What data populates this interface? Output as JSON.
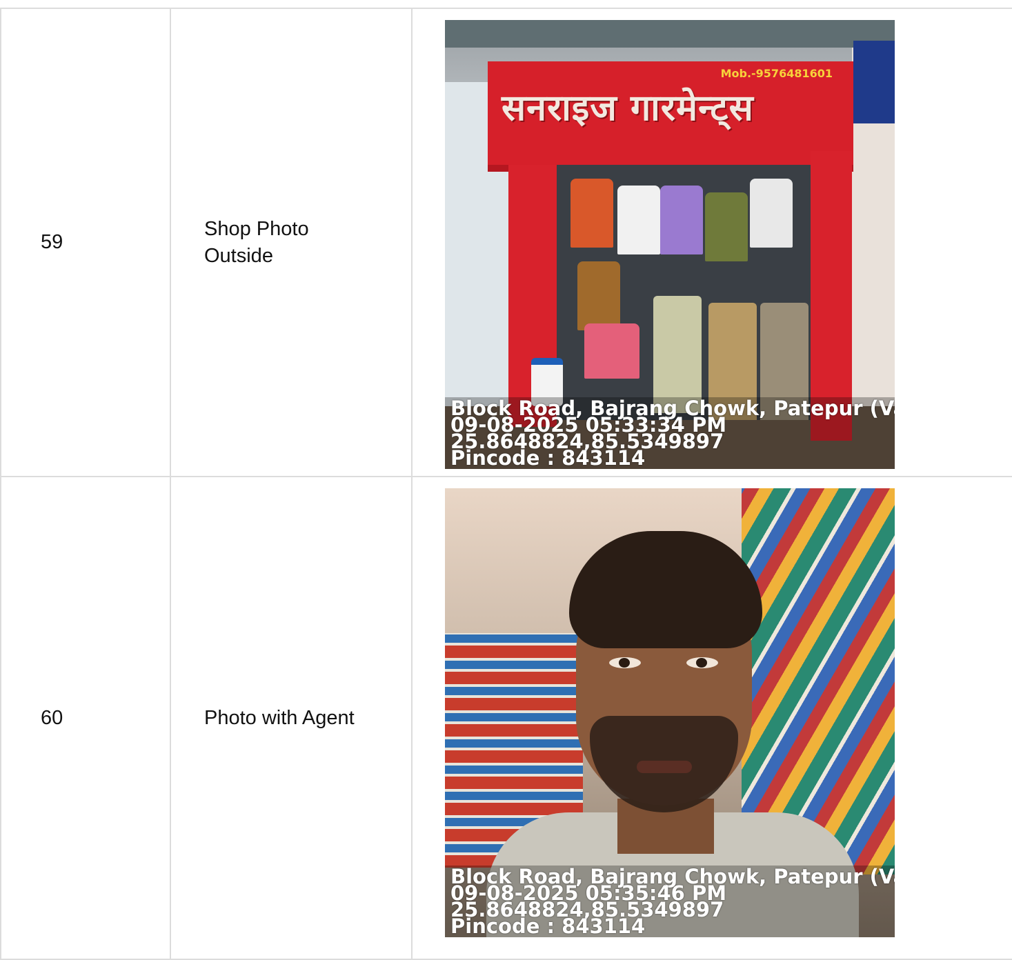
{
  "rows": [
    {
      "number": "59",
      "label": "Shop Photo Outside",
      "photo": {
        "sign_text": "सनराइज गारमेन्ट्स",
        "sign_mobile": "Mob.-9576481601",
        "stamp": {
          "address": "Block Road, Bajrang Chowk, Patepur (Vaisha",
          "datetime": "09-08-2025 05:33:34 PM",
          "coordinates": "25.8648824,85.5349897",
          "pincode": "Pincode : 843114"
        }
      }
    },
    {
      "number": "60",
      "label": "Photo with Agent",
      "photo": {
        "stamp": {
          "address": "Block Road, Bajrang Chowk, Patepur (Vaisha",
          "datetime": "09-08-2025 05:35:46 PM",
          "coordinates": "25.8648824,85.5349897",
          "pincode": "Pincode : 843114"
        }
      }
    }
  ],
  "colors": {
    "border": "#dcdcdc",
    "sign_red": "#d6202a",
    "stamp_text": "#ffffff"
  }
}
